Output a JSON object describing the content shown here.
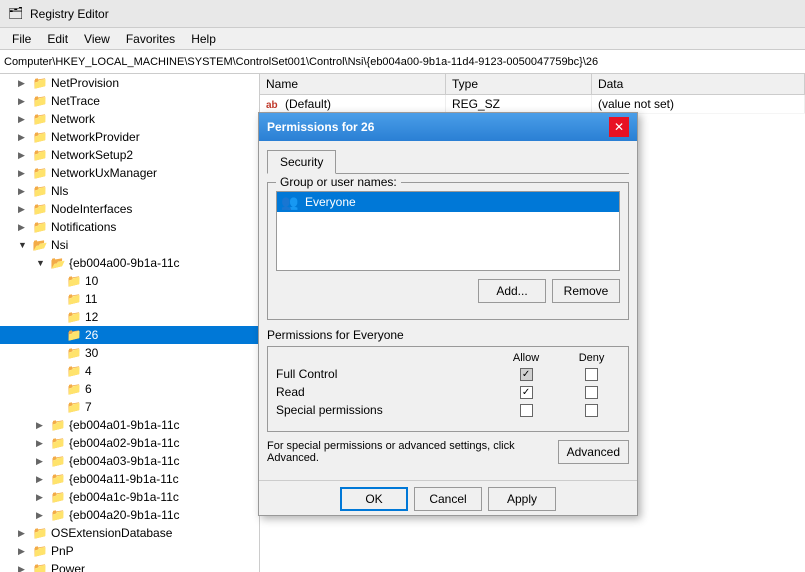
{
  "app": {
    "title": "Registry Editor",
    "icon": "🗂"
  },
  "menu": {
    "items": [
      "File",
      "Edit",
      "View",
      "Favorites",
      "Help"
    ]
  },
  "address": {
    "path": "Computer\\HKEY_LOCAL_MACHINE\\SYSTEM\\ControlSet001\\Control\\Nsi\\{eb004a00-9b1a-11d4-9123-0050047759bc}\\26"
  },
  "tree": {
    "items": [
      {
        "id": "netprovision",
        "label": "NetProvision",
        "indent": 1,
        "expanded": false,
        "selected": false
      },
      {
        "id": "nettrace",
        "label": "NetTrace",
        "indent": 1,
        "expanded": false,
        "selected": false
      },
      {
        "id": "network",
        "label": "Network",
        "indent": 1,
        "expanded": false,
        "selected": false
      },
      {
        "id": "networkprovider",
        "label": "NetworkProvider",
        "indent": 1,
        "expanded": false,
        "selected": false
      },
      {
        "id": "networksetup2",
        "label": "NetworkSetup2",
        "indent": 1,
        "expanded": false,
        "selected": false
      },
      {
        "id": "networkuxmanager",
        "label": "NetworkUxManager",
        "indent": 1,
        "expanded": false,
        "selected": false
      },
      {
        "id": "nls",
        "label": "Nls",
        "indent": 1,
        "expanded": false,
        "selected": false
      },
      {
        "id": "nodeinterfaces",
        "label": "NodeInterfaces",
        "indent": 1,
        "expanded": false,
        "selected": false
      },
      {
        "id": "notifications",
        "label": "Notifications",
        "indent": 1,
        "expanded": false,
        "selected": false
      },
      {
        "id": "nsi",
        "label": "Nsi",
        "indent": 1,
        "expanded": true,
        "selected": false
      },
      {
        "id": "eb004a00",
        "label": "{eb004a00-9b1a-11c",
        "indent": 2,
        "expanded": true,
        "selected": false
      },
      {
        "id": "10",
        "label": "10",
        "indent": 3,
        "expanded": false,
        "selected": false
      },
      {
        "id": "11",
        "label": "11",
        "indent": 3,
        "expanded": false,
        "selected": false
      },
      {
        "id": "12",
        "label": "12",
        "indent": 3,
        "expanded": false,
        "selected": false
      },
      {
        "id": "26",
        "label": "26",
        "indent": 3,
        "expanded": false,
        "selected": true
      },
      {
        "id": "30",
        "label": "30",
        "indent": 3,
        "expanded": false,
        "selected": false
      },
      {
        "id": "4",
        "label": "4",
        "indent": 3,
        "expanded": false,
        "selected": false
      },
      {
        "id": "6",
        "label": "6",
        "indent": 3,
        "expanded": false,
        "selected": false
      },
      {
        "id": "7",
        "label": "7",
        "indent": 3,
        "expanded": false,
        "selected": false
      },
      {
        "id": "eb004a01",
        "label": "{eb004a01-9b1a-11c",
        "indent": 2,
        "expanded": false,
        "selected": false
      },
      {
        "id": "eb004a02",
        "label": "{eb004a02-9b1a-11c",
        "indent": 2,
        "expanded": false,
        "selected": false
      },
      {
        "id": "eb004a03",
        "label": "{eb004a03-9b1a-11c",
        "indent": 2,
        "expanded": false,
        "selected": false
      },
      {
        "id": "eb004a11",
        "label": "{eb004a11-9b1a-11c",
        "indent": 2,
        "expanded": false,
        "selected": false
      },
      {
        "id": "eb004a1c",
        "label": "{eb004a1c-9b1a-11c",
        "indent": 2,
        "expanded": false,
        "selected": false
      },
      {
        "id": "eb004a20",
        "label": "{eb004a20-9b1a-11c",
        "indent": 2,
        "expanded": false,
        "selected": false
      },
      {
        "id": "osextension",
        "label": "OSExtensionDatabase",
        "indent": 1,
        "expanded": false,
        "selected": false
      },
      {
        "id": "pnp",
        "label": "PnP",
        "indent": 1,
        "expanded": false,
        "selected": false
      },
      {
        "id": "power",
        "label": "Power",
        "indent": 1,
        "expanded": false,
        "selected": false
      }
    ]
  },
  "registry_table": {
    "columns": [
      "Name",
      "Type",
      "Data"
    ],
    "rows": [
      {
        "name": "(Default)",
        "type": "REG_SZ",
        "data": "(value not set)",
        "icon": "ab"
      }
    ]
  },
  "dialog": {
    "title": "Permissions for 26",
    "tab": "Security",
    "group_label": "Group or user names:",
    "users": [
      {
        "name": "Everyone",
        "icon": "👥"
      }
    ],
    "add_btn": "Add...",
    "remove_btn": "Remove",
    "permissions_label": "Permissions for Everyone",
    "permissions_columns": {
      "allow": "Allow",
      "deny": "Deny"
    },
    "permissions_rows": [
      {
        "name": "Full Control",
        "allow": true,
        "allow_gray": true,
        "deny": false
      },
      {
        "name": "Read",
        "allow": true,
        "allow_gray": false,
        "deny": false
      },
      {
        "name": "Special permissions",
        "allow": false,
        "allow_gray": false,
        "deny": false
      }
    ],
    "note": "For special permissions or advanced settings, click Advanced.",
    "advanced_btn": "Advanced",
    "ok_btn": "OK",
    "cancel_btn": "Cancel",
    "apply_btn": "Apply"
  }
}
